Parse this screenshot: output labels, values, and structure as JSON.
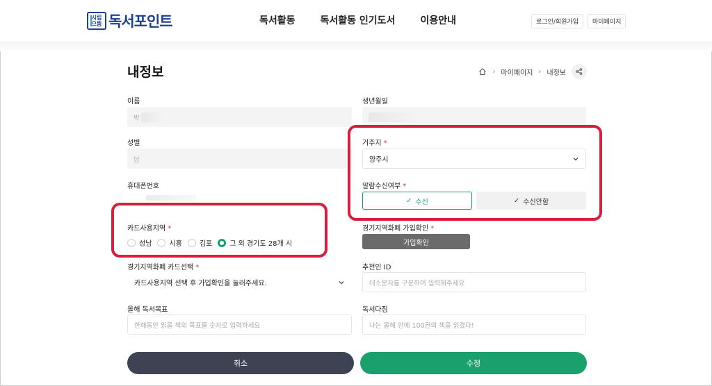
{
  "header": {
    "logo_mark_top": "시립",
    "logo_mark_bottom": "으뜸",
    "logo_text": "독서포인트",
    "nav": [
      "독서활동",
      "독서활동 인기도서",
      "이용안내"
    ],
    "login_label": "로그인/회원가입",
    "mypage_label": "마이페이지"
  },
  "page": {
    "title": "내정보",
    "breadcrumb": [
      "마이페이지",
      "내정보"
    ]
  },
  "form": {
    "name_label": "이름",
    "name_value": "박",
    "birth_label": "생년월일",
    "gender_label": "성별",
    "gender_value": "남",
    "residence_label": "거주지",
    "residence_value": "양주시",
    "phone_label": "휴대폰번호",
    "alarm_label": "알람수신여부",
    "alarm_options": [
      "수신",
      "수신안함"
    ],
    "alarm_selected": "수신",
    "card_region_label": "카드사용지역",
    "card_regions": [
      "성남",
      "시흥",
      "김포",
      "그 외 경기도 28개 시"
    ],
    "card_region_selected": "그 외 경기도 28개 시",
    "gyeonggi_join_label": "경기지역화폐 가입확인",
    "gyeonggi_join_button": "가입확인",
    "card_select_label": "경기지역화폐 카드선택",
    "card_select_value": "카드사용지역 선택 후 가입확인을 눌러주세요.",
    "referrer_label": "추천인 ID",
    "referrer_placeholder": "대소문자를 구분하여 입력해주세요",
    "goal_label": "올해 독서목표",
    "goal_placeholder": "한해동안 읽을 책의 목표를 숫자로 입력하세요",
    "pledge_label": "독서다짐",
    "pledge_placeholder": "나는 올해 안에 100권의 책을 읽겠다!"
  },
  "actions": {
    "cancel": "취소",
    "submit": "수정"
  },
  "colors": {
    "brand": "#1e3f8c",
    "accent_green": "#1aa06b",
    "cancel_bg": "#3d4352",
    "required": "#e0344b",
    "highlight": "#d81e3c"
  }
}
